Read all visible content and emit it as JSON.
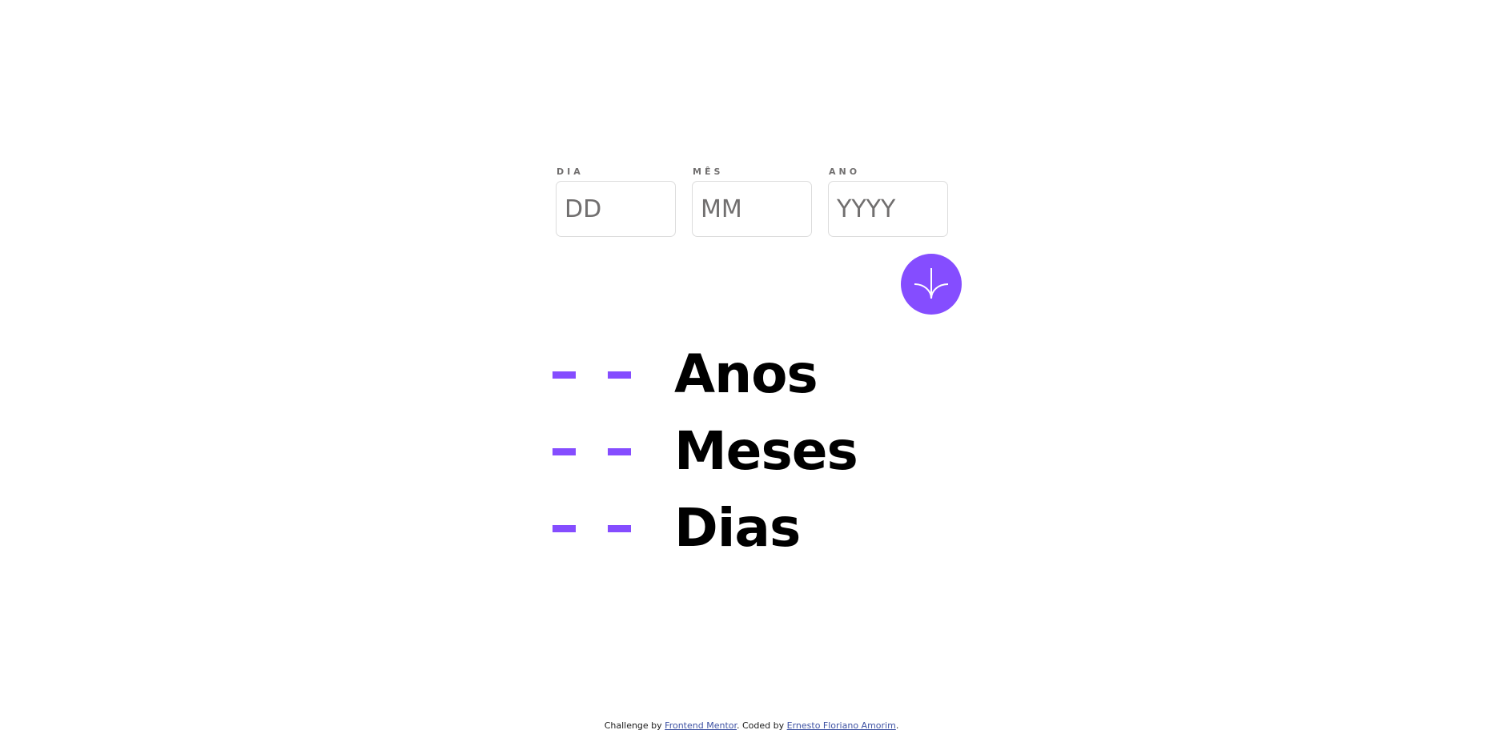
{
  "form": {
    "fields": [
      {
        "label": "DIA",
        "placeholder": "DD",
        "value": ""
      },
      {
        "label": "MÊS",
        "placeholder": "MM",
        "value": ""
      },
      {
        "label": "ANO",
        "placeholder": "YYYY",
        "value": ""
      }
    ],
    "submit_icon": "arrow-down-icon"
  },
  "results": [
    {
      "value": "- -",
      "unit": "Anos"
    },
    {
      "value": "- -",
      "unit": "Meses"
    },
    {
      "value": "- -",
      "unit": "Dias"
    }
  ],
  "footer": {
    "prefix": "Challenge by ",
    "challenge_link": "Frontend Mentor",
    "middle": ". Coded by ",
    "author_link": "Ernesto Floriano Amorim",
    "suffix": "."
  },
  "colors": {
    "accent": "#854dff",
    "label": "#716f6f",
    "border": "#dcdcdc",
    "text": "#000000"
  }
}
